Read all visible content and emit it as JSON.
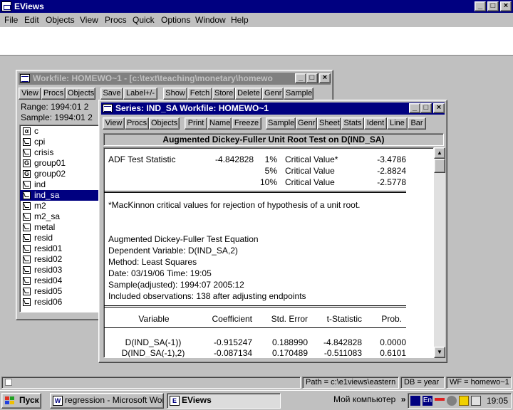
{
  "app": {
    "title": "EViews",
    "menu": [
      "File",
      "Edit",
      "Objects",
      "View",
      "Procs",
      "Quick",
      "Options",
      "Window",
      "Help"
    ],
    "caption_min": "_",
    "caption_max": "□",
    "caption_close": "×"
  },
  "workfile": {
    "title": "Workfile: HOMEWO~1 - [c:\\text\\teaching\\monetary\\homewo",
    "buttons": [
      "View",
      "Procs",
      "Objects",
      "Save",
      "Label+/-",
      "Show",
      "Fetch",
      "Store",
      "Delete",
      "Genr",
      "Sample"
    ],
    "range": "Range:  1994:01 2",
    "sample": "Sample: 1994:01 2",
    "items": [
      {
        "name": "c",
        "icon": "alpha-icon",
        "glyph": "α"
      },
      {
        "name": "cpi",
        "icon": "series-icon",
        "glyph": ""
      },
      {
        "name": "crisis",
        "icon": "series-icon",
        "glyph": ""
      },
      {
        "name": "group01",
        "icon": "group-icon",
        "glyph": "G"
      },
      {
        "name": "group02",
        "icon": "group-icon",
        "glyph": "G"
      },
      {
        "name": "ind",
        "icon": "series-icon",
        "glyph": ""
      },
      {
        "name": "ind_sa",
        "icon": "series-icon",
        "glyph": "",
        "selected": true
      },
      {
        "name": "m2",
        "icon": "series-icon",
        "glyph": ""
      },
      {
        "name": "m2_sa",
        "icon": "series-icon",
        "glyph": ""
      },
      {
        "name": "metal",
        "icon": "series-icon",
        "glyph": ""
      },
      {
        "name": "resid",
        "icon": "series-icon",
        "glyph": ""
      },
      {
        "name": "resid01",
        "icon": "series-icon",
        "glyph": ""
      },
      {
        "name": "resid02",
        "icon": "series-icon",
        "glyph": ""
      },
      {
        "name": "resid03",
        "icon": "series-icon",
        "glyph": ""
      },
      {
        "name": "resid04",
        "icon": "series-icon",
        "glyph": ""
      },
      {
        "name": "resid05",
        "icon": "series-icon",
        "glyph": ""
      },
      {
        "name": "resid06",
        "icon": "series-icon",
        "glyph": ""
      }
    ]
  },
  "series": {
    "title": "Series: IND_SA   Workfile: HOMEWO~1",
    "buttons": [
      "View",
      "Procs",
      "Objects",
      "Print",
      "Name",
      "Freeze",
      "Sample",
      "Genr",
      "Sheet",
      "Stats",
      "Ident",
      "Line",
      "Bar"
    ],
    "header": "Augmented Dickey-Fuller Unit Root Test on D(IND_SA)",
    "adf": {
      "label": "ADF Test Statistic",
      "value": "-4.842828",
      "rows": [
        {
          "pct": "1%",
          "label": "Critical Value*",
          "value": "-3.4786"
        },
        {
          "pct": "5%",
          "label": "Critical Value",
          "value": "-2.8824"
        },
        {
          "pct": "10%",
          "label": "Critical Value",
          "value": "-2.5778"
        }
      ]
    },
    "note": "*MacKinnon critical values for rejection of hypothesis of a unit root.",
    "equation": [
      "Augmented Dickey-Fuller Test Equation",
      "Dependent Variable: D(IND_SA,2)",
      "Method: Least Squares",
      "Date: 03/19/06   Time: 19:05",
      "Sample(adjusted): 1994:07 2005:12",
      "Included observations: 138 after adjusting endpoints"
    ],
    "table": {
      "headers": [
        "Variable",
        "Coefficient",
        "Std. Error",
        "t-Statistic",
        "Prob."
      ],
      "rows": [
        [
          "D(IND_SA(-1))",
          "-0.915247",
          "0.188990",
          "-4.842828",
          "0.0000"
        ],
        [
          "D(IND_SA(-1),2)",
          "-0.087134",
          "0.170489",
          "-0.511083",
          "0.6101"
        ]
      ]
    }
  },
  "status": {
    "path": "Path = c:\\e1views\\eastern",
    "db": "DB = year",
    "wf": "WF = homewo~1"
  },
  "taskbar": {
    "start": "Пуск",
    "tasks": [
      "regression - Microsoft Word",
      "EViews"
    ],
    "my_computer": "Мой компьютер",
    "chevron": "»",
    "lang": "En",
    "clock": "19:05"
  }
}
